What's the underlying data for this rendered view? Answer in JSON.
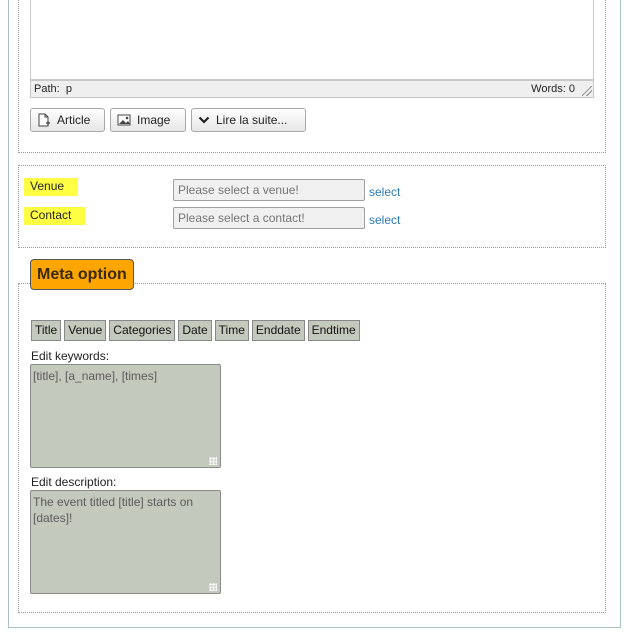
{
  "editor": {
    "path_label": "Path:",
    "path_value": "p",
    "words_label": "Words:",
    "words_value": "0",
    "buttons": {
      "article": "Article",
      "image": "Image",
      "read_more": "Lire la suite..."
    }
  },
  "venue": {
    "label": "Venue",
    "placeholder": "Please select a venue!",
    "select": "select"
  },
  "contact": {
    "label": "Contact",
    "placeholder": "Please select a contact!",
    "select": "select"
  },
  "meta": {
    "legend": "Meta option",
    "tags": [
      "Title",
      "Venue",
      "Categories",
      "Date",
      "Time",
      "Enddate",
      "Endtime"
    ],
    "keywords_label": "Edit keywords:",
    "keywords_value": "[title], [a_name], [times]",
    "description_label": "Edit description:",
    "description_value": "The event titled [title] starts on [dates]!"
  },
  "colors": {
    "highlight": "#ffff44",
    "legend_bg": "#ffa500",
    "link": "#2a7ab8",
    "field_bg": "#c4c9bd"
  }
}
